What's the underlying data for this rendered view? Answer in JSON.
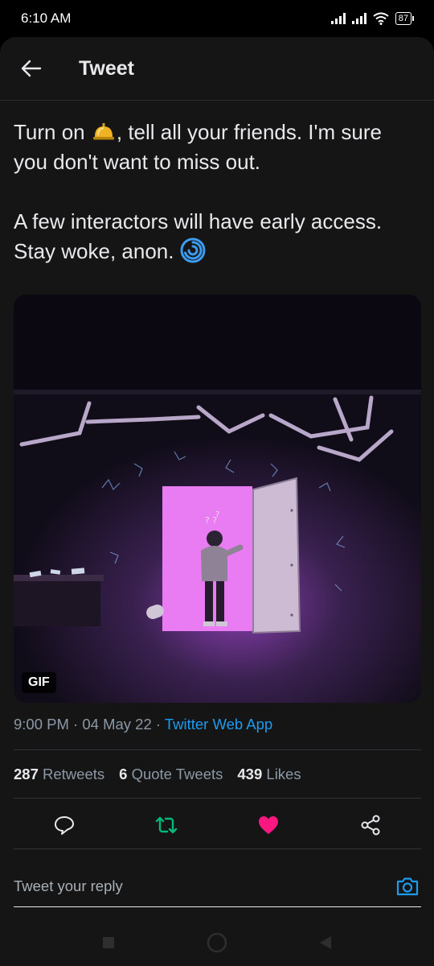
{
  "status_bar": {
    "time": "6:10 AM",
    "battery": "87"
  },
  "header": {
    "title": "Tweet"
  },
  "tweet": {
    "line1_before": "Turn on ",
    "line1_after": ", tell all your friends. I'm sure you don't want to miss out.",
    "paragraph2": "A few interactors will have early access. Stay woke, anon.",
    "bell_icon": "bellhop-bell-icon",
    "swirl_icon": "cyclone-icon"
  },
  "media": {
    "badge": "GIF"
  },
  "meta": {
    "time": "9:00 PM",
    "separator": " · ",
    "date": "04 May 22",
    "source": "Twitter Web App"
  },
  "stats": {
    "retweets_count": "287",
    "retweets_label": "Retweets",
    "quotes_count": "6",
    "quotes_label": "Quote Tweets",
    "likes_count": "439",
    "likes_label": "Likes"
  },
  "colors": {
    "retweet": "#00ba7c",
    "like": "#f91880",
    "link": "#1d9bf0"
  },
  "reply": {
    "placeholder": "Tweet your reply"
  }
}
